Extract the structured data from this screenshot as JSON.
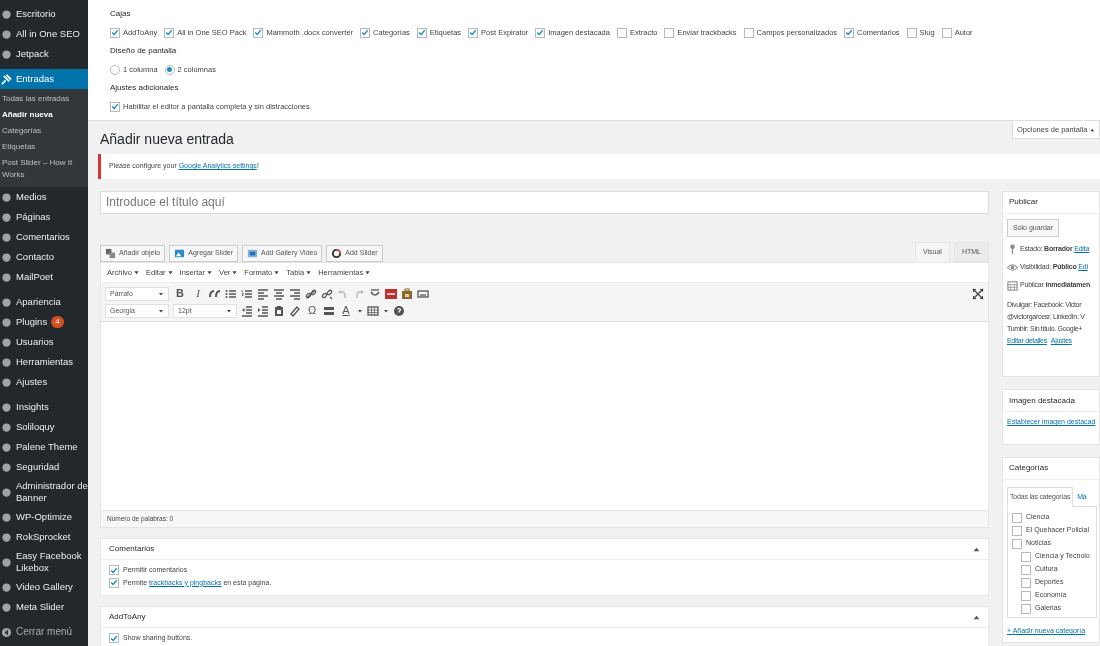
{
  "sidebar": {
    "items": [
      {
        "label": "Escritorio",
        "selected": false
      },
      {
        "label": "All in One SEO",
        "selected": false
      },
      {
        "label": "Jetpack",
        "selected": false
      },
      {
        "label": "Entradas",
        "selected": true,
        "children": [
          {
            "label": "Todas las entradas",
            "selected": false
          },
          {
            "label": "Añadir nueva",
            "selected": true
          },
          {
            "label": "Categorías",
            "selected": false
          },
          {
            "label": "Etiquetas",
            "selected": false
          },
          {
            "label": "Post Slider – How It Works",
            "selected": false
          }
        ]
      },
      {
        "label": "Medios",
        "selected": false
      },
      {
        "label": "Páginas",
        "selected": false
      },
      {
        "label": "Comentarios",
        "selected": false
      },
      {
        "label": "Contacto",
        "selected": false
      },
      {
        "label": "MailPoet",
        "selected": false
      },
      {
        "label": "Apariencia",
        "selected": false
      },
      {
        "label": "Plugins",
        "selected": false,
        "badge": "4"
      },
      {
        "label": "Usuarios",
        "selected": false
      },
      {
        "label": "Herramientas",
        "selected": false
      },
      {
        "label": "Ajustes",
        "selected": false
      },
      {
        "label": "Insights",
        "selected": false
      },
      {
        "label": "Soliloquy",
        "selected": false
      },
      {
        "label": "Palene Theme",
        "selected": false
      },
      {
        "label": "Seguridad",
        "selected": false
      },
      {
        "label": "Administrador de Banner",
        "selected": false
      },
      {
        "label": "WP-Optimize",
        "selected": false
      },
      {
        "label": "RokSprocket",
        "selected": false
      },
      {
        "label": "Easy Facebook Likebox",
        "selected": false
      },
      {
        "label": "Video Gallery",
        "selected": false
      },
      {
        "label": "Meta Slider",
        "selected": false
      }
    ],
    "collapse_label": "Cerrar menú"
  },
  "screen_options": {
    "boxes_title": "Cajas",
    "boxes": [
      {
        "label": "AddToAny",
        "checked": true
      },
      {
        "label": "All in One SEO Pack",
        "checked": true
      },
      {
        "label": "Mammoth .docx converter",
        "checked": true
      },
      {
        "label": "Categorías",
        "checked": true
      },
      {
        "label": "Etiquetas",
        "checked": true
      },
      {
        "label": "Post Expirator",
        "checked": true
      },
      {
        "label": "Imagen destacada",
        "checked": true
      },
      {
        "label": "Extracto",
        "checked": false
      },
      {
        "label": "Enviar trackbacks",
        "checked": false
      },
      {
        "label": "Campos personalizados",
        "checked": false
      },
      {
        "label": "Comentarios",
        "checked": true
      },
      {
        "label": "Slug",
        "checked": false
      },
      {
        "label": "Autor",
        "checked": false
      }
    ],
    "layout_title": "Diseño de pantalla",
    "layout": [
      {
        "label": "1 columna",
        "selected": false
      },
      {
        "label": "2 columnas",
        "selected": true
      }
    ],
    "extra_title": "Ajustes adicionales",
    "extra": [
      {
        "label": "Habilitar el editor a pantalla completa y sin distracciones.",
        "checked": true
      }
    ],
    "tab_label": "Opciones de pantalla"
  },
  "page_title": "Añadir nueva entrada",
  "notice": {
    "text": "Please configure your ",
    "link": "Google Analytics settings",
    "after": "!"
  },
  "title_placeholder": "Introduce el título aquí",
  "media_buttons": [
    "Añadir objeto",
    "Agregar Slider",
    "Add Gallery Video",
    "Add Slider"
  ],
  "editor_tabs": [
    {
      "label": "Visual",
      "selected": true
    },
    {
      "label": "HTML",
      "selected": false
    }
  ],
  "menubar": [
    "Archivo",
    "Editar",
    "Insertar",
    "Ver",
    "Formato",
    "Tabla",
    "Herramientas"
  ],
  "toolbar": {
    "format_select": "Párrafo",
    "font_select": "Georgia",
    "size_select": "12pt",
    "bold": "B",
    "italic": "I",
    "omega": "Ω",
    "text_color": "A"
  },
  "word_count": "Número de palabras: 0",
  "comments_box": {
    "title": "Comentarios",
    "options": [
      {
        "before": "Permitir comentarios",
        "checked": true
      },
      {
        "before": "Permite ",
        "link": "trackbacks y pingbacks",
        "after": " en esta página.",
        "checked": true
      }
    ]
  },
  "addtoany_box": {
    "title": "AddToAny",
    "options": [
      {
        "before": "Show sharing buttons.",
        "checked": true
      }
    ]
  },
  "publish": {
    "title": "Publicar",
    "save_label": "Sólo guardar",
    "rows": [
      {
        "kind": "status",
        "text": "Estado: **Borrador** ",
        "link": "Edita"
      },
      {
        "kind": "visibility",
        "text": "Visibilidad: **Público** ",
        "link": "Edi"
      },
      {
        "kind": "schedule",
        "text": "Publicar **inmediatamen**"
      }
    ],
    "share_lines": [
      "Divulgar: Facebook: Victor",
      "@victorgarcesr. LinkedIn: V",
      "Tumblr: Sin título. Google+"
    ],
    "links": [
      "Editar detalles",
      "Ajustes"
    ]
  },
  "featured": {
    "title": "Imagen destacada",
    "link": "Establecer imagen destacad"
  },
  "categories": {
    "title": "Categorías",
    "tabs": [
      {
        "label": "Todas las categorías",
        "selected": true
      },
      {
        "label": "Má",
        "selected": false
      }
    ],
    "items": [
      {
        "label": "Ciencia",
        "checked": false
      },
      {
        "label": "El Quehacer Policial",
        "checked": false
      },
      {
        "label": "Noticias",
        "checked": false,
        "children": [
          {
            "label": "Ciencia y Tecnolo",
            "checked": false
          },
          {
            "label": "Cultura",
            "checked": false
          },
          {
            "label": "Deportes",
            "checked": false
          },
          {
            "label": "Economía",
            "checked": false
          },
          {
            "label": "Galerias",
            "checked": false
          }
        ]
      }
    ],
    "add_link": "+ Añadir nueva categoría"
  }
}
